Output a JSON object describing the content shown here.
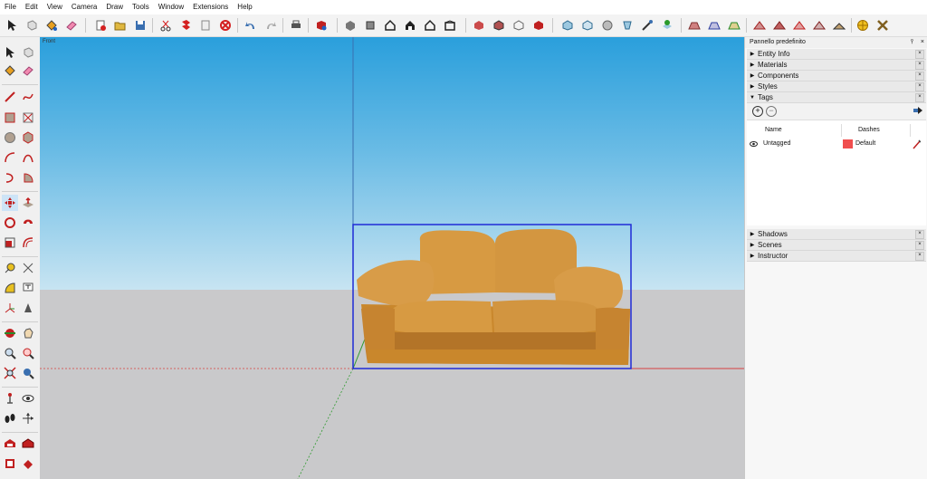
{
  "menu": [
    "File",
    "Edit",
    "View",
    "Camera",
    "Draw",
    "Tools",
    "Window",
    "Extensions",
    "Help"
  ],
  "viewport": {
    "view_label": "Front"
  },
  "panel": {
    "title": "Pannello predefinito",
    "pin_icon": "pin-icon",
    "close_glyph": "×",
    "trays_top": [
      {
        "label": "Entity Info",
        "expanded": false
      },
      {
        "label": "Materials",
        "expanded": false
      },
      {
        "label": "Components",
        "expanded": false
      },
      {
        "label": "Styles",
        "expanded": false
      },
      {
        "label": "Tags",
        "expanded": true
      }
    ],
    "tags": {
      "col_name": "Name",
      "col_dashes": "Dashes",
      "rows": [
        {
          "name": "Untagged",
          "color": "#f04e4e",
          "dashes": "Default"
        }
      ]
    },
    "trays_bottom": [
      {
        "label": "Shadows",
        "expanded": false
      },
      {
        "label": "Scenes",
        "expanded": false
      },
      {
        "label": "Instructor",
        "expanded": false
      }
    ]
  },
  "colors": {
    "sky_top": "#2a9fdc",
    "ground": "#c9c9cb",
    "selection": "#1f2bd6",
    "red_axis": "#d84040",
    "green_axis": "#2f9a2f",
    "blue_axis": "#3a6fb0"
  }
}
